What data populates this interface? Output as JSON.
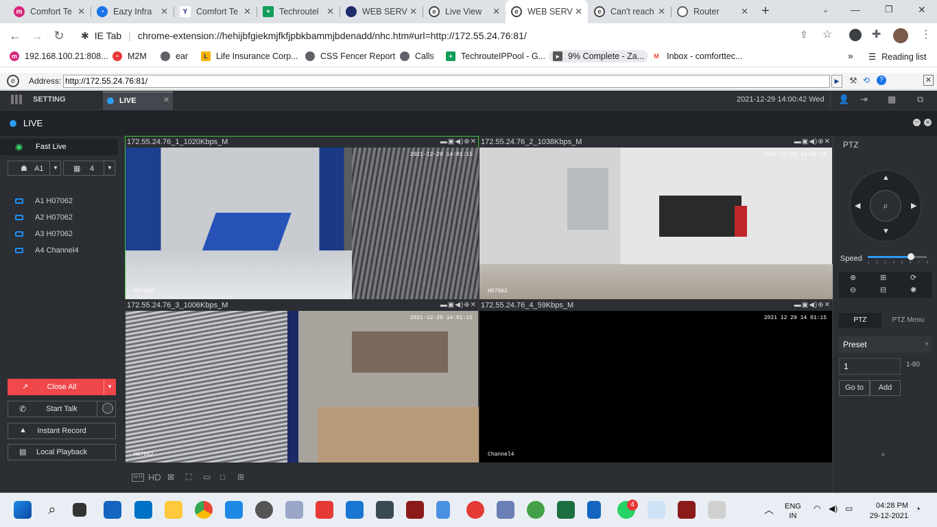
{
  "browser": {
    "tabs": [
      {
        "title": "Comfort Te",
        "icon": "m-icon",
        "color": "#d6287a"
      },
      {
        "title": "Eazy Infra",
        "icon": "eazy-icon",
        "color": "#1a73e8"
      },
      {
        "title": "Comfort Te",
        "icon": "y-icon",
        "color": "#202124"
      },
      {
        "title": "Techroutel",
        "icon": "sheets-icon",
        "color": "#0f9d58"
      },
      {
        "title": "WEB SERV",
        "icon": "globe-dark-icon",
        "color": "#1f2a6b"
      },
      {
        "title": "Live View",
        "icon": "ie-tab-icon",
        "color": "#444"
      },
      {
        "title": "WEB SERV",
        "icon": "ie-tab-icon",
        "color": "#444"
      },
      {
        "title": "Can't reach",
        "icon": "ie-tab-icon",
        "color": "#444"
      },
      {
        "title": "Router",
        "icon": "globe-icon",
        "color": "#5f6368"
      }
    ],
    "new_tab": "+",
    "url_prefix": "IE Tab",
    "url": "chrome-extension://hehijbfgiekmjfkfjpbkbammjbdenadd/nhc.htm#url=http://172.55.24.76:81/",
    "bookmarks": [
      {
        "label": "192.168.100.21:808...",
        "color": "#d6287a"
      },
      {
        "label": "M2M",
        "color": "#e53935"
      },
      {
        "label": "ear",
        "color": "#5f6368"
      },
      {
        "label": "Life Insurance Corp...",
        "color": "#f5b400"
      },
      {
        "label": "CSS Fencer Report",
        "color": "#5f6368"
      },
      {
        "label": "Calls",
        "color": "#5f6368"
      },
      {
        "label": "TechrouteIPPool - G...",
        "color": "#0f9d58"
      },
      {
        "label": "9% Complete - Za...",
        "color": "#555"
      },
      {
        "label": "Inbox - comforttec...",
        "color": "#ea4335"
      }
    ],
    "bookmarks_more": "»",
    "reading_list": "Reading list",
    "ie_address_label": "Address:",
    "ie_address": "http://172.55.24.76:81/"
  },
  "app": {
    "setting_tab": "SETTING",
    "live_tab": "LIVE",
    "datetime": "2021-12-29 14:00:42 Wed",
    "live_title": "LIVE",
    "fast_live": "Fast Live",
    "stream_select": "A1",
    "split_select": "4",
    "cameras": [
      "A1 H07062",
      "A2 H07062",
      "A3 H07062",
      "A4 Channel4"
    ],
    "close_all": "Close All",
    "start_talk": "Start Talk",
    "instant_record": "Instant Record",
    "local_playback": "Local Playback",
    "bottom_hd": "HD",
    "feeds": [
      {
        "header": "172.55.24.76_1_1020Kbps_M",
        "timestamp": "2021-12-29 14:01:15",
        "name": "H07062"
      },
      {
        "header": "172.55.24.76_2_1038Kbps_M",
        "timestamp": "2021-12-29 14:01:15",
        "name": "H07062"
      },
      {
        "header": "172.55.24.76_3_1006Kbps_M",
        "timestamp": "2021-12-29 14:01:15",
        "name": "H07062"
      },
      {
        "header": "172.55.24.76_4_59Kbps_M",
        "timestamp": "2021 12 29 14 01:15",
        "name": "Channel4"
      }
    ],
    "ptz": {
      "title": "PTZ",
      "speed_label": "Speed",
      "speed_ticks": [
        "1",
        "2",
        "3",
        "4",
        "5",
        "6",
        "7",
        "8"
      ],
      "speed_value": 6,
      "tab_ptz": "PTZ",
      "tab_menu": "PTZ Menu",
      "preset_label": "Preset",
      "preset_value": "1",
      "preset_range": "1-80",
      "goto": "Go to",
      "add": "Add"
    }
  },
  "taskbar": {
    "lang_top": "ENG",
    "lang_bottom": "IN",
    "time": "04:28 PM",
    "date": "29-12-2021",
    "whatsapp_badge": "4"
  }
}
